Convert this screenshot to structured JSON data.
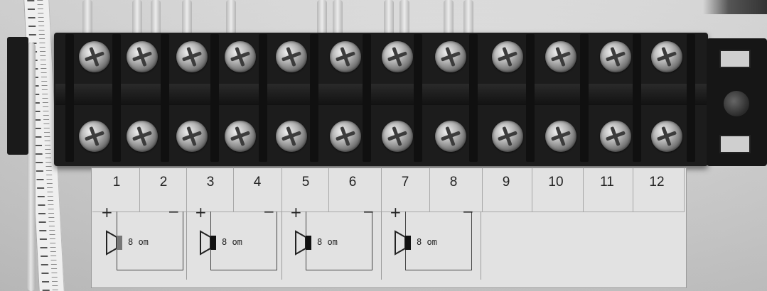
{
  "terminal_numbers": [
    "1",
    "2",
    "3",
    "4",
    "5",
    "6",
    "7",
    "8",
    "9",
    "10",
    "11",
    "12"
  ],
  "speaker_channels": [
    {
      "plus": "+",
      "minus": "−",
      "impedance": "8 om"
    },
    {
      "plus": "+",
      "minus": "−",
      "impedance": "8 om"
    },
    {
      "plus": "+",
      "minus": "−",
      "impedance": "8 om"
    },
    {
      "plus": "+",
      "minus": "−",
      "impedance": "8 om"
    }
  ]
}
